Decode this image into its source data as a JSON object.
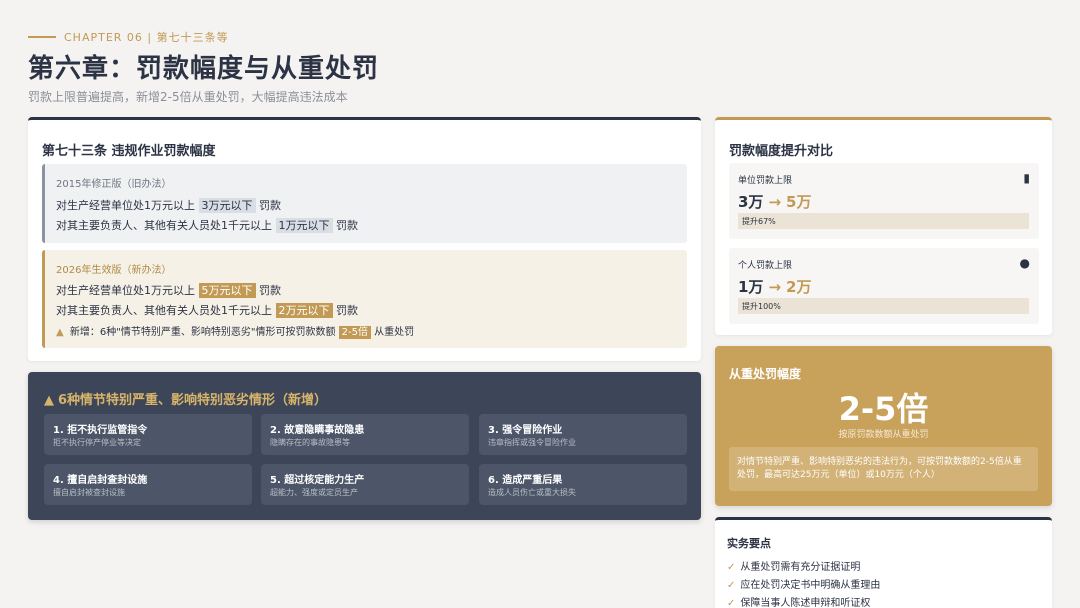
{
  "header": {
    "kicker": "CHAPTER 06 | 第七十三条等",
    "title": "第六章：罚款幅度与从重处罚",
    "subtitle": "罚款上限普遍提高，新增2-5倍从重处罚，大幅提高违法成本"
  },
  "article": {
    "title": "第七十三条 违规作业罚款幅度",
    "old": {
      "label": "2015年修正版（旧办法）",
      "line1_pre": "对生产经营单位处1万元以上",
      "line1_tag": "3万元以下",
      "line1_post": "罚款",
      "line2_pre": "对其主要负责人、其他有关人员处1千元以上",
      "line2_tag": "1万元以下",
      "line2_post": "罚款"
    },
    "new": {
      "label": "2026年生效版（新办法）",
      "line1_pre": "对生产经营单位处1万元以上",
      "line1_tag": "5万元以下",
      "line1_post": "罚款",
      "line2_pre": "对其主要负责人、其他有关人员处1千元以上",
      "line2_tag": "2万元以下",
      "line2_post": "罚款",
      "warn_pre": "新增：6种\"情节特别严重、影响特别恶劣\"情形可按罚款数额",
      "warn_tag": "2-5倍",
      "warn_post": "从重处罚"
    }
  },
  "situations": {
    "title": "6种情节特别严重、影响特别恶劣情形（新增）",
    "items": [
      {
        "title": "1. 拒不执行监管指令",
        "desc": "拒不执行停产停业等决定"
      },
      {
        "title": "2. 故意隐瞒事故隐患",
        "desc": "隐瞒存在的事故隐患等"
      },
      {
        "title": "3. 强令冒险作业",
        "desc": "违章指挥或强令冒险作业"
      },
      {
        "title": "4. 擅自启封查封设施",
        "desc": "擅自启封被查封设施"
      },
      {
        "title": "5. 超过核定能力生产",
        "desc": "超能力、强度或定员生产"
      },
      {
        "title": "6. 造成严重后果",
        "desc": "造成人员伤亡或重大损失"
      }
    ]
  },
  "compare": {
    "title": "罚款幅度提升对比",
    "unit": {
      "label": "单位罚款上限",
      "icon": "building-icon",
      "from": "3万",
      "arrow": "→",
      "to": "5万",
      "increase": "提升67%"
    },
    "person": {
      "label": "个人罚款上限",
      "icon": "user-icon",
      "from": "1万",
      "arrow": "→",
      "to": "2万",
      "increase": "提升100%"
    }
  },
  "aggravated": {
    "title": "从重处罚幅度",
    "value": "2-5倍",
    "sub": "按原罚款数额从重处罚",
    "note": "对情节特别严重、影响特别恶劣的违法行为，可按罚款数额的2-5倍从重处罚，最高可达25万元（单位）或10万元（个人）"
  },
  "practice": {
    "title": "实务要点",
    "items": [
      "从重处罚需有充分证据证明",
      "应在处罚决定书中明确从重理由",
      "保障当事人陈述申辩和听证权"
    ]
  },
  "colors": {
    "navy": "#2c3344",
    "gold": "#c29a55",
    "dark_panel": "#3c4658"
  }
}
